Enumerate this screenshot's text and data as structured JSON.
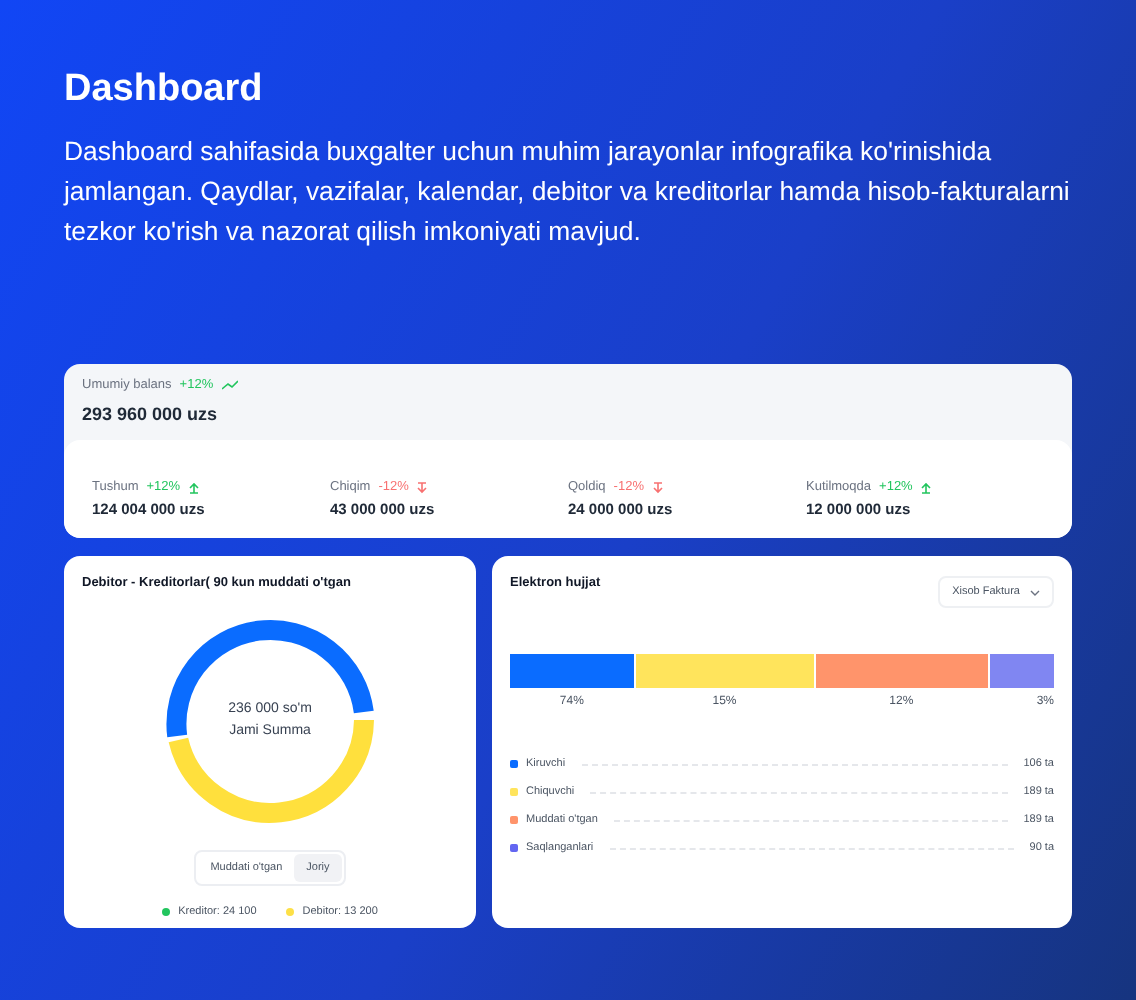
{
  "header": {
    "title": "Dashboard",
    "description": "Dashboard sahifasida buxgalter uchun muhim jarayonlar infografika ko'rinishida jamlangan. Qaydlar, vazifalar, kalendar, debitor va kreditorlar hamda hisob-fakturalarni tezkor ko'rish va nazorat qilish imkoniyati mavjud."
  },
  "balance": {
    "label": "Umumiy balans",
    "change": "+12%",
    "rising": true,
    "value": "293 960 000 uzs"
  },
  "stats": [
    {
      "label": "Tushum",
      "change": "+12%",
      "rising": true,
      "value": "124 004 000 uzs"
    },
    {
      "label": "Chiqim",
      "change": "-12%",
      "rising": false,
      "value": "43 000 000 uzs"
    },
    {
      "label": "Qoldiq",
      "change": "-12%",
      "rising": false,
      "value": "24 000 000 uzs"
    },
    {
      "label": "Kutilmoqda",
      "change": "+12%",
      "rising": true,
      "value": "12 000 000 uzs"
    }
  ],
  "debtors": {
    "title": "Debitor - Kreditorlar( 90 kun muddati o'tgan",
    "total": "236 000 so'm",
    "total_label": "Jami Summa",
    "toggle": [
      {
        "label": "Muddati o'tgan",
        "selected": false
      },
      {
        "label": "Joriy",
        "selected": true
      }
    ],
    "legend": [
      {
        "label": "Kreditor: 24 100",
        "color": "#22c55e"
      },
      {
        "label": "Debitor: 13 200",
        "color": "#fde047"
      }
    ]
  },
  "documents": {
    "title": "Elektron hujjat",
    "dropdown": "Xisob Faktura",
    "segments": [
      {
        "label": "74%",
        "color": "#0a6cff"
      },
      {
        "label": "15%",
        "color": "#ffe45c"
      },
      {
        "label": "12%",
        "color": "#ff946b"
      },
      {
        "label": "3%",
        "color": "#8086f2"
      }
    ],
    "items": [
      {
        "label": "Kiruvchi",
        "count": "106 ta",
        "color": "#0a6cff"
      },
      {
        "label": "Chiquvchi",
        "count": "189 ta",
        "color": "#ffe45c"
      },
      {
        "label": "Muddati o'tgan",
        "count": "189 ta",
        "color": "#ff946b"
      },
      {
        "label": "Saqlanganlari",
        "count": "90 ta",
        "color": "#6366f1"
      }
    ]
  }
}
